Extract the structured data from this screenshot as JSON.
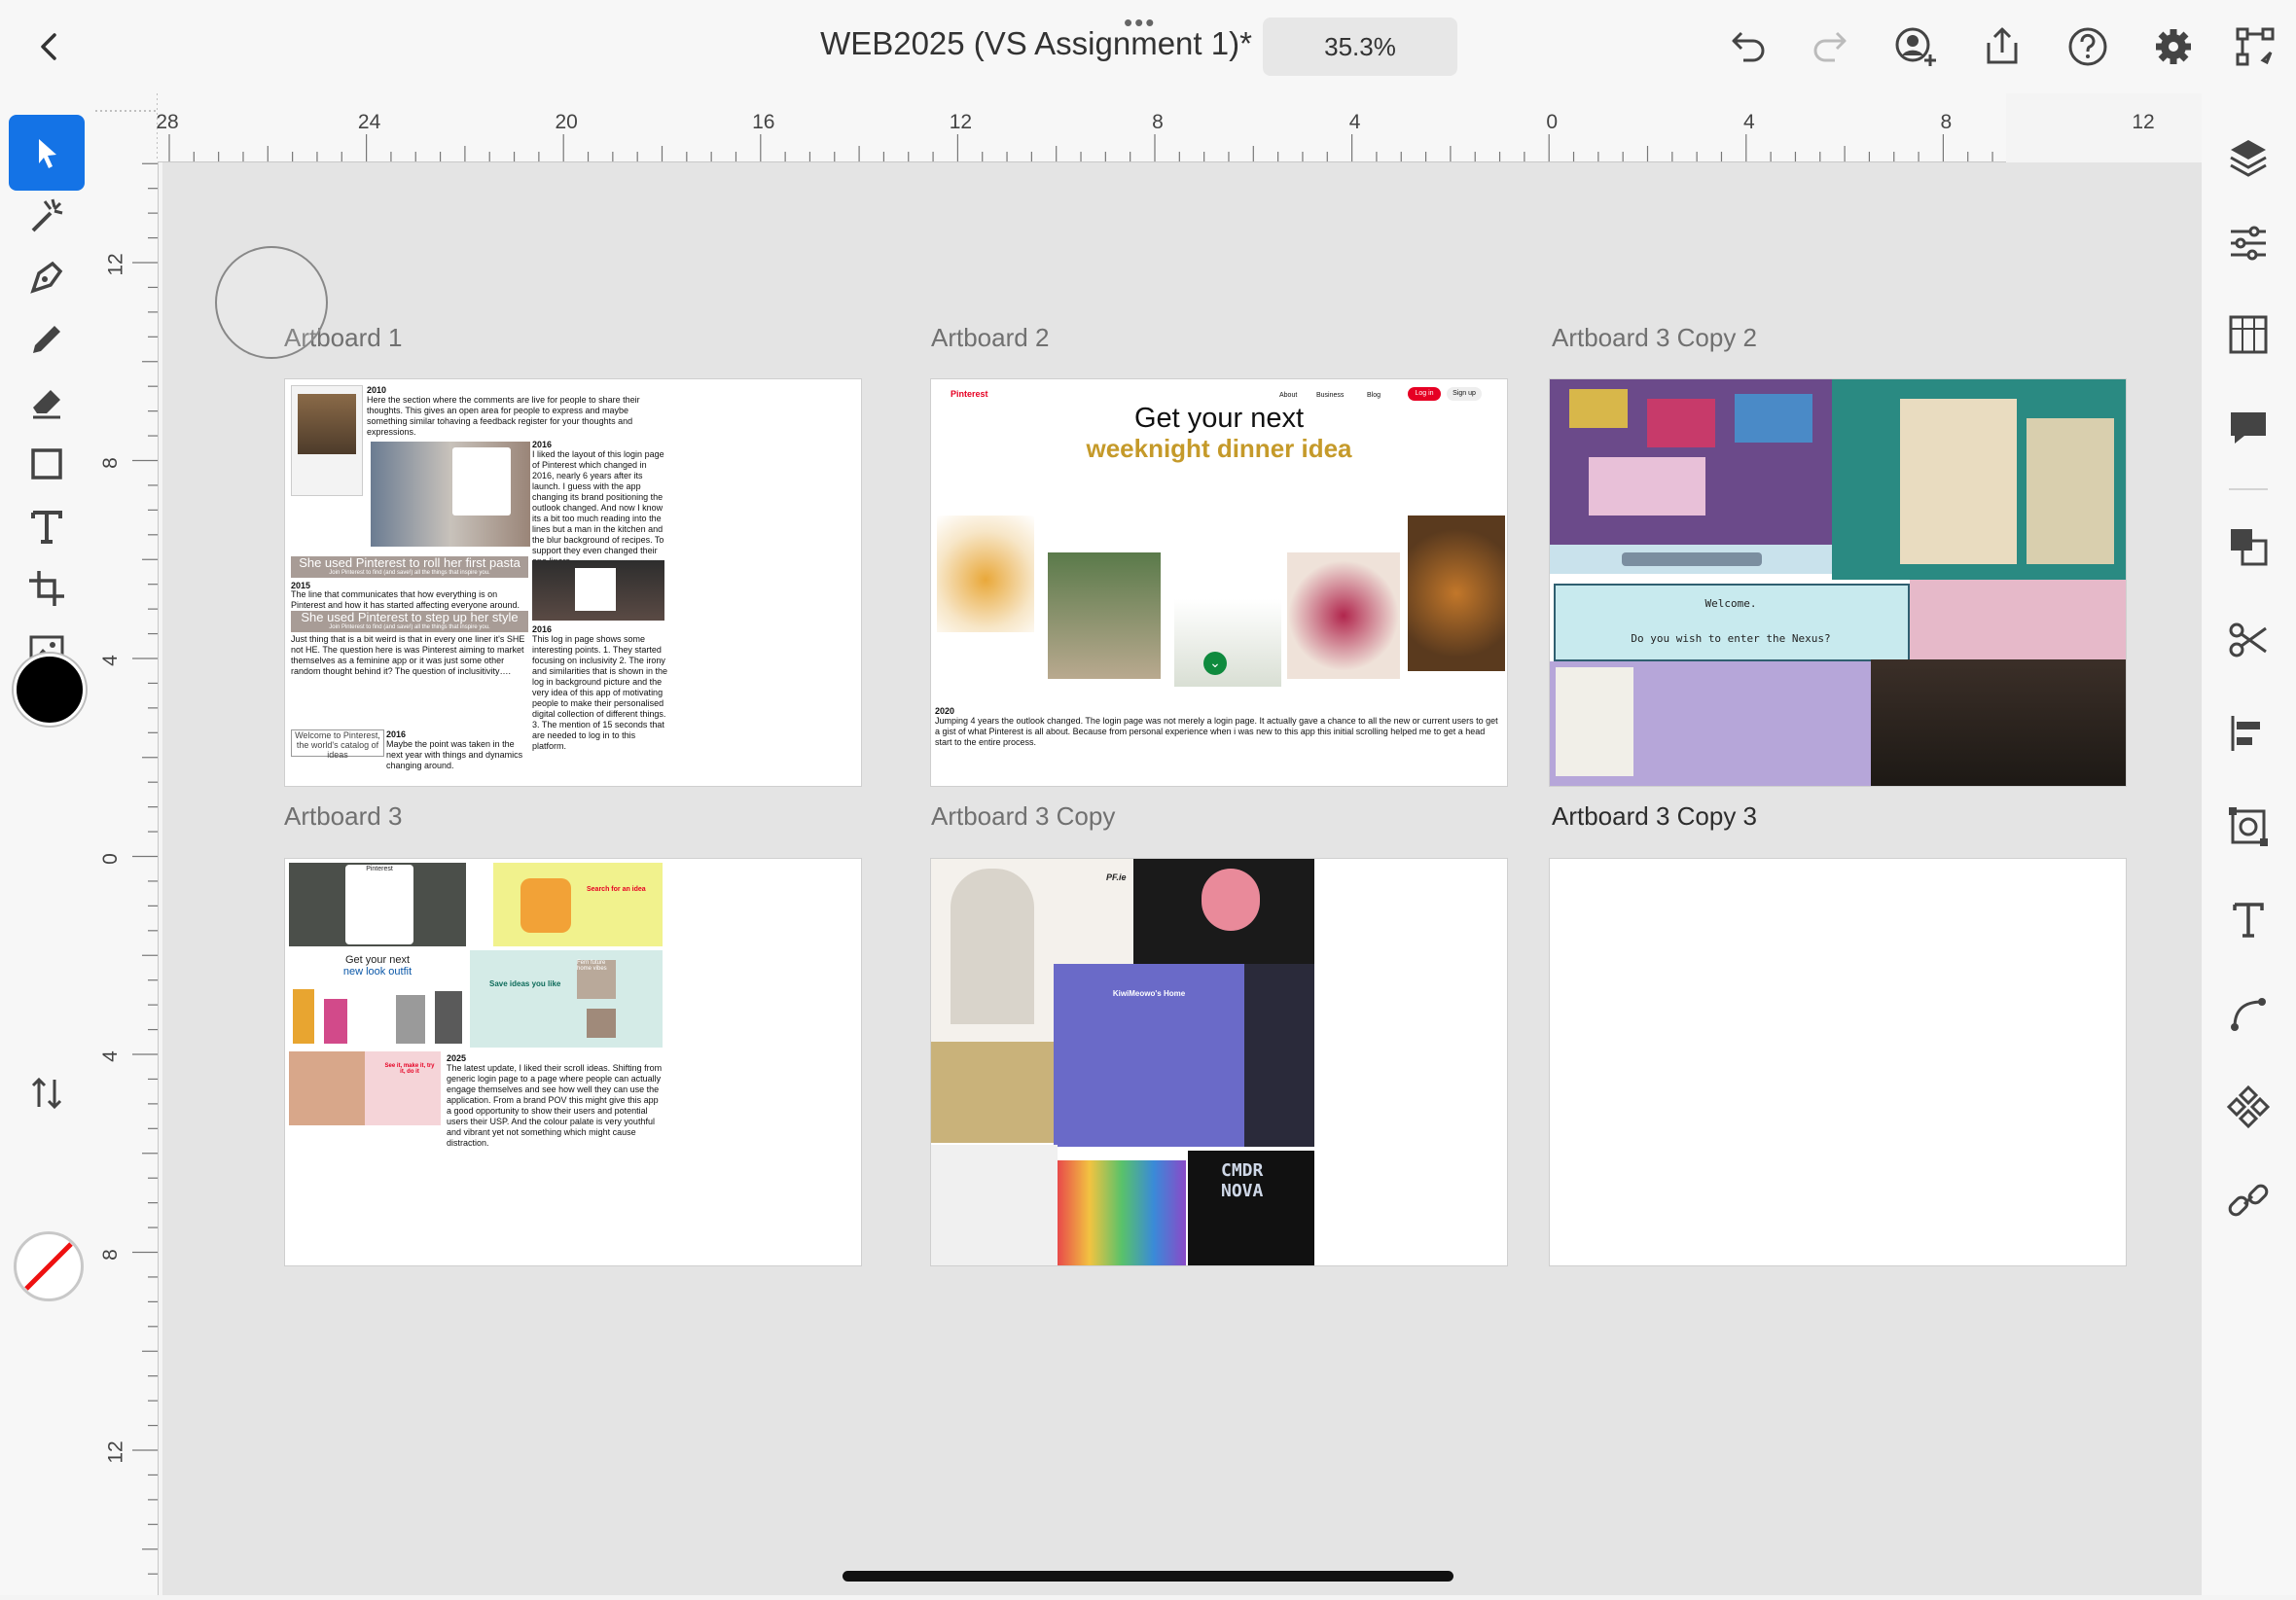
{
  "top_bar": {
    "title": "WEB2025 (VS Assignment 1)*",
    "zoom": "35.3%",
    "grip": "•••"
  },
  "left_tools": [
    "select-tool",
    "repeat-grid-tool",
    "pen-tool",
    "pencil-tool",
    "eraser-tool",
    "rectangle-tool",
    "text-tool",
    "artboard-tool",
    "image-tool"
  ],
  "colors": {
    "accent": "#1473e6",
    "fill": "#000000"
  },
  "rulers": {
    "horizontal": [
      "28",
      "24",
      "20",
      "16",
      "12",
      "8",
      "4",
      "0",
      "4",
      "8",
      "12"
    ],
    "vertical": [
      "12",
      "8",
      "4",
      "0",
      "4",
      "8",
      "12"
    ]
  },
  "artboards": [
    {
      "name": "Artboard 1"
    },
    {
      "name": "Artboard 2"
    },
    {
      "name": "Artboard 3 Copy 2"
    },
    {
      "name": "Artboard 3"
    },
    {
      "name": "Artboard 3 Copy"
    },
    {
      "name": "Artboard 3 Copy 3"
    }
  ],
  "ab1": {
    "y2010": "2010",
    "t2010": "Here the section where the comments are live for people to share their thoughts. This gives an open area for people to express and maybe something similar tohaving a feedback register for your thoughts and expressions.",
    "y2016a": "2016",
    "t2016a": "I liked the layout of this login page of Pinterest which changed in 2016, nearly 6 years after its launch. I guess with the app changing its brand positioning the outlook changed. And now I know its a bit too much reading into the lines but a man in the kitchen and the blur background of recipes. To support they even changed their one liners.",
    "banner1": "She used Pinterest to roll her first pasta",
    "banner1_sub": "Join Pinterest to find (and save!) all the things that inspire you.",
    "y2015": "2015",
    "t2015": "The line that communicates that how everything is on Pinterest and how it has started affecting everyone around. The site keeps on updating these lines.",
    "banner2": "She used Pinterest to step up her style",
    "banner2_sub": "Join Pinterest to find (and save!) all the things that inspire you.",
    "t_weird": "Just thing that is a bit weird is that in every one liner it's SHE not HE. The question here is was Pinterest aiming to market themselves as a feminine app or it was just some other random thought behind it? The question of inclusitivity….",
    "y2016b": "2016",
    "t2016b": "This log in page shows some interesting points. 1. They started focusing on inclusivity 2. The irony and similarities that is shown in the log in background picture and the very idea of this app of motivating people to make their personalised digital collection of different things. 3. The mention of 15 seconds that are needed to log in to this platform.",
    "welcome": "Welcome to Pinterest, the world's catalog of ideas",
    "y2016c": "2016",
    "t2016c": "Maybe the point was taken in the next year with things and dynamics changing around."
  },
  "ab2": {
    "logo": "Pinterest",
    "nav": [
      "About",
      "Business",
      "Blog"
    ],
    "login": "Log in",
    "signup": "Sign up",
    "headline1": "Get your next",
    "headline2": "weeknight dinner idea",
    "y2020": "2020",
    "t2020": "Jumping 4 years the outlook changed. The login page was not merely a login page. It actually gave a chance to all the new or current users to get a gist of what Pinterest is all about. Because from personal experience when i was new to this app this initial scrolling helped me to get a head start to the entire process."
  },
  "ab3c2": {
    "welcome": "Welcome.",
    "nexus": "Do you wish to enter the Nexus?"
  },
  "ab3": {
    "pinterest": "Pinterest",
    "search_idea": "Search for an idea",
    "look1": "Get your next",
    "look2": "new look outfit",
    "save_ideas": "Save ideas you like",
    "fern": "Fern future home vibes",
    "see_it": "See it, make it, try it, do it",
    "y2025": "2025",
    "t2025": "The latest update, I liked their scroll ideas. Shifting from generic login page to a page where people can actually engage themselves and see how well they can use the application. From a brand POV this might give this app a good opportunity to show their users and potential users their USP. And the colour palate is very youthful and vibrant yet not something which might cause distraction."
  },
  "ab3c": {
    "pf": "PF.ie",
    "kiwi": "KiwiMeowo's Home",
    "cmdr": "CMDR NOVA"
  }
}
